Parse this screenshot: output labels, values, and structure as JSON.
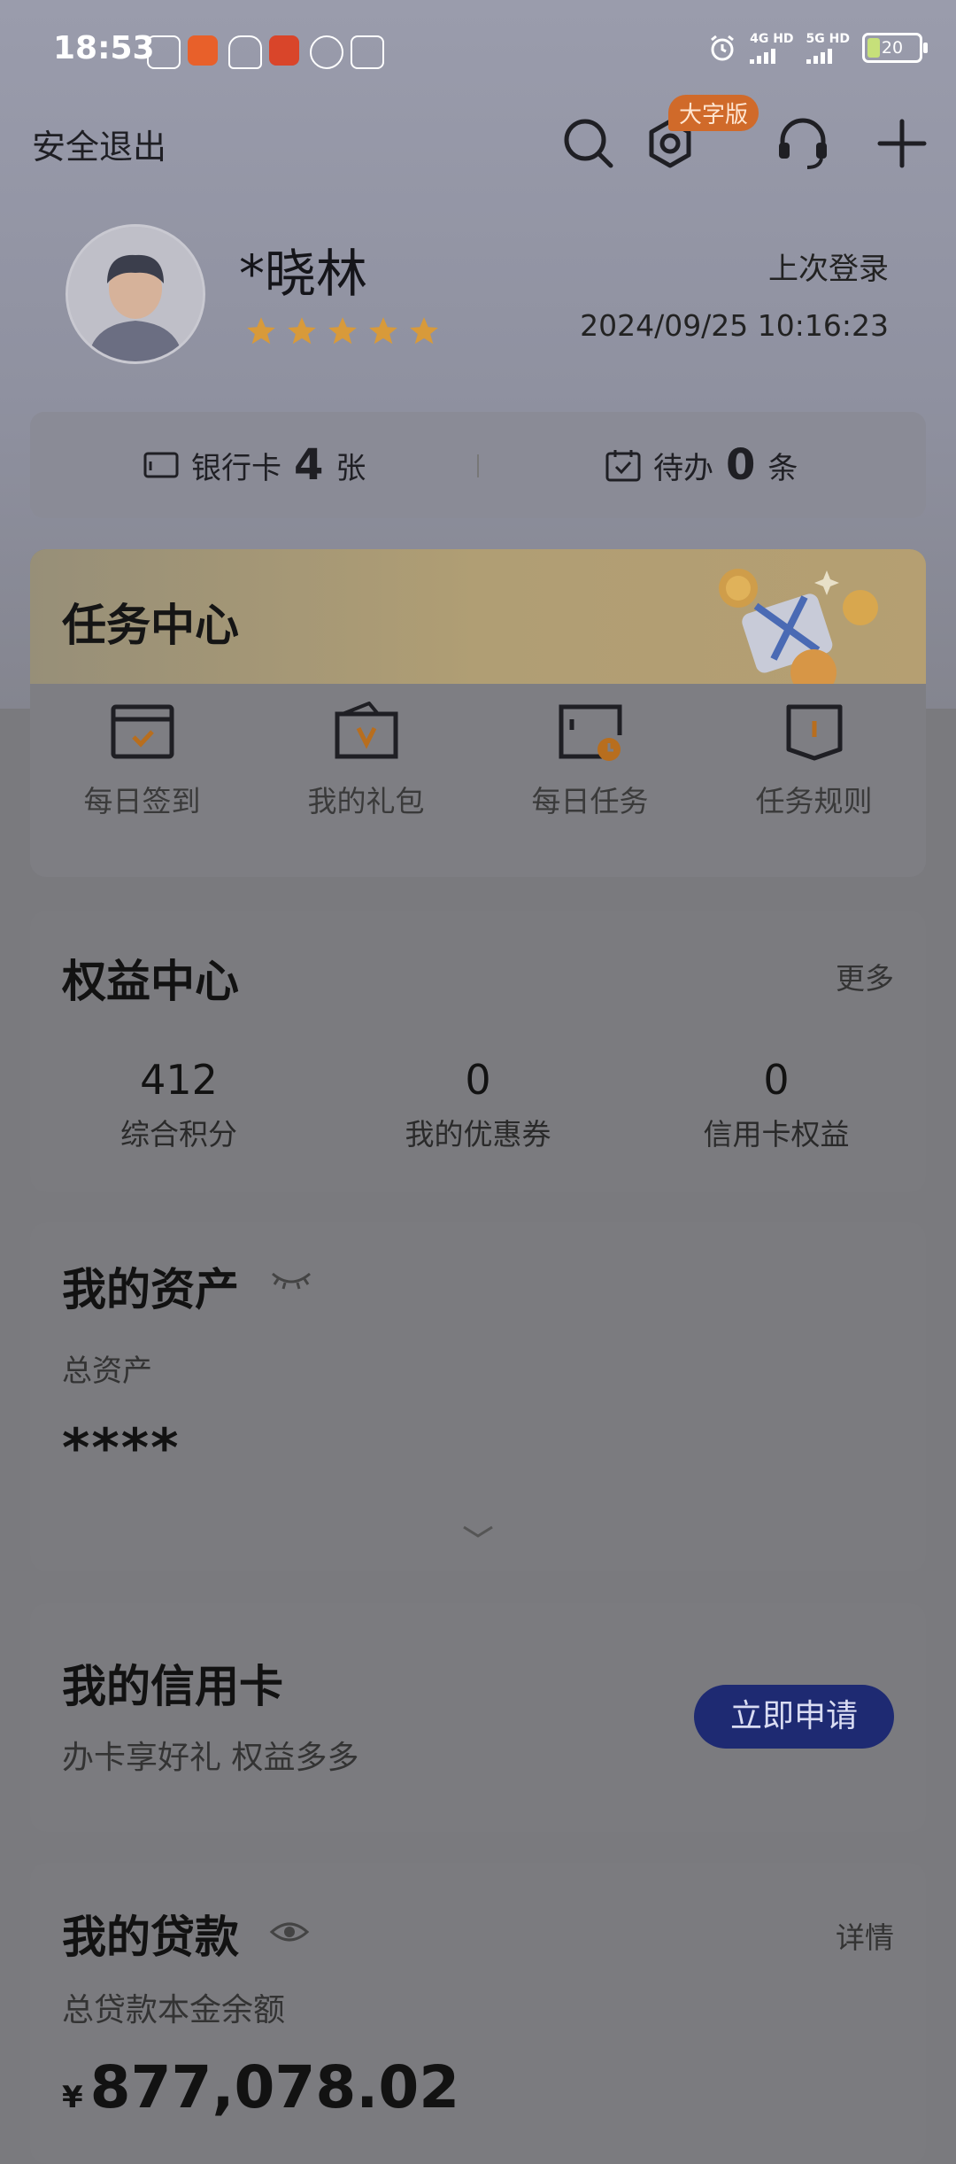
{
  "status_bar": {
    "time": "18:53",
    "net1": "4G HD",
    "net2": "5G HD",
    "battery": "20"
  },
  "topnav": {
    "logout": "安全退出",
    "big_font_badge": "大字版"
  },
  "profile": {
    "name": "*晓林",
    "stars": 5,
    "last_login_label": "上次登录",
    "last_login_time": "2024/09/25 10:16:23"
  },
  "summary": {
    "bank_label": "银行卡",
    "bank_count": "4",
    "bank_unit": "张",
    "todo_label": "待办",
    "todo_count": "0",
    "todo_unit": "条"
  },
  "task_center": {
    "title": "任务中心",
    "items": [
      {
        "label": "每日签到",
        "icon": "calendar-check-icon"
      },
      {
        "label": "我的礼包",
        "icon": "gift-folder-icon"
      },
      {
        "label": "每日任务",
        "icon": "task-clock-icon"
      },
      {
        "label": "任务规则",
        "icon": "rule-book-icon"
      }
    ]
  },
  "rights_center": {
    "title": "权益中心",
    "more": "更多",
    "items": [
      {
        "value": "412",
        "label": "综合积分"
      },
      {
        "value": "0",
        "label": "我的优惠券"
      },
      {
        "value": "0",
        "label": "信用卡权益"
      }
    ]
  },
  "assets": {
    "title": "我的资产",
    "total_label": "总资产",
    "total_value": "****"
  },
  "credit_card": {
    "title": "我的信用卡",
    "subtitle": "办卡享好礼 权益多多",
    "apply": "立即申请"
  },
  "loan": {
    "title": "我的贷款",
    "detail": "详情",
    "balance_label": "总贷款本金余额",
    "currency": "¥",
    "balance": "877,078.02"
  },
  "colors": {
    "apply_button": "#1e2a72",
    "badge": "#d06a2a",
    "star": "#d89a3a"
  }
}
